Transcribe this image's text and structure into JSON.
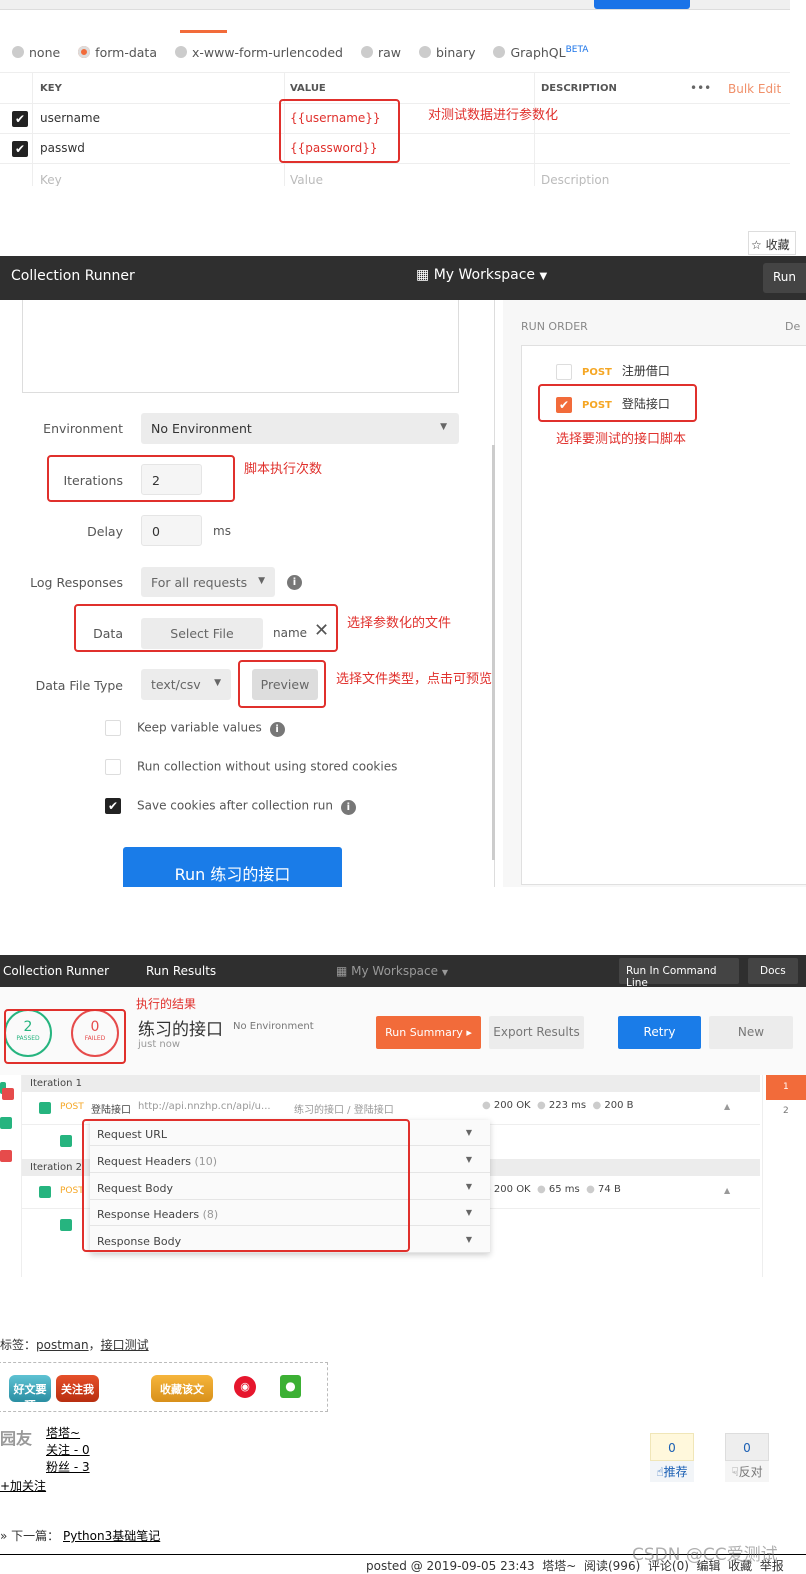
{
  "body_panel": {
    "body_types": [
      {
        "label": "none",
        "selected": false
      },
      {
        "label": "form-data",
        "selected": true
      },
      {
        "label": "x-www-form-urlencoded",
        "selected": false
      },
      {
        "label": "raw",
        "selected": false
      },
      {
        "label": "binary",
        "selected": false
      },
      {
        "label": "GraphQL",
        "selected": false
      }
    ],
    "beta_badge": "BETA",
    "table": {
      "headers": [
        "KEY",
        "VALUE",
        "DESCRIPTION"
      ],
      "more": "•••",
      "bulk_edit": "Bulk Edit",
      "rows": [
        {
          "checked": true,
          "key": "username",
          "value": "{{username}}"
        },
        {
          "checked": true,
          "key": "passwd",
          "value": "{{password}}"
        }
      ],
      "placeholder": {
        "key": "Key",
        "value": "Value",
        "description": "Description"
      }
    },
    "annotation": "对测试数据进行参数化"
  },
  "favorite_button": "☆ 收藏",
  "runner": {
    "title": "Collection Runner",
    "workspace": "My Workspace",
    "run_btn": "Run",
    "fields": {
      "environment_label": "Environment",
      "environment_value": "No Environment",
      "iterations_label": "Iterations",
      "iterations_value": "2",
      "delay_label": "Delay",
      "delay_value": "0",
      "delay_unit": "ms",
      "log_label": "Log Responses",
      "log_value": "For all requests",
      "data_label": "Data",
      "select_file": "Select File",
      "file_name": "name",
      "file_type_label": "Data File Type",
      "file_type_value": "text/csv",
      "preview": "Preview"
    },
    "checkboxes": [
      {
        "label": "Keep variable values",
        "checked": false,
        "info": true
      },
      {
        "label": "Run collection without using stored cookies",
        "checked": false,
        "info": false
      },
      {
        "label": "Save cookies after collection run",
        "checked": true,
        "info": true
      }
    ],
    "run_button": "Run 练习的接口",
    "annotations": {
      "iterations": "脚本执行次数",
      "data": "选择参数化的文件",
      "preview": "选择文件类型，点击可预览",
      "run_order": "选择要测试的接口脚本"
    },
    "run_order": {
      "title": "RUN ORDER",
      "deselect": "De",
      "items": [
        {
          "method": "POST",
          "name": "注册借口",
          "checked": false
        },
        {
          "method": "POST",
          "name": "登陆接口",
          "checked": true
        }
      ]
    }
  },
  "results": {
    "breadcrumbs": [
      "Collection Runner",
      "Run Results"
    ],
    "workspace": "My Workspace",
    "run_cli": "Run In Command Line",
    "docs": "Docs",
    "annotation": "执行的结果",
    "passed": {
      "count": "2",
      "label": "PASSED"
    },
    "failed": {
      "count": "0",
      "label": "FAILED"
    },
    "collection": "练习的接口",
    "environment": "No Environment",
    "time": "just now",
    "buttons": {
      "summary": "Run Summary",
      "export": "Export Results",
      "retry": "Retry",
      "new": "New"
    },
    "iterations": [
      {
        "label": "Iteration 1",
        "method": "POST",
        "name": "登陆接口",
        "url": "http://api.nnzhp.cn/api/u...",
        "path": "练习的接口 / 登陆接口",
        "status": "200 OK",
        "time": "223 ms",
        "size": "200 B"
      },
      {
        "label": "Iteration 2",
        "method": "POST",
        "name": "",
        "url": "",
        "path": "",
        "status": "200 OK",
        "time": "65 ms",
        "size": "74 B"
      }
    ],
    "dropdown": [
      {
        "label": "Request URL",
        "count": ""
      },
      {
        "label": "Request Headers",
        "count": "(10)"
      },
      {
        "label": "Request Body",
        "count": ""
      },
      {
        "label": "Response Headers",
        "count": "(8)"
      },
      {
        "label": "Response Body",
        "count": ""
      }
    ],
    "iteration_nav": [
      "1",
      "2"
    ]
  },
  "blog": {
    "tags_label": "标签：",
    "tags": [
      "postman",
      "接口测试"
    ],
    "share_buttons": [
      "好文要顶",
      "关注我",
      "收藏该文"
    ],
    "author": "塔塔~",
    "following": "关注 - 0",
    "followers": "粉丝 - 3",
    "follow": "+加关注",
    "avatar_text": "园友",
    "recommend": {
      "count": "0",
      "label": "推荐"
    },
    "oppose": {
      "count": "0",
      "label": "反对"
    },
    "next_label": "» 下一篇：",
    "next_title": "Python3基础笔记",
    "footer": "posted @ 2019-09-05 23:43  塔塔~  阅读(996)  评论(0)  编辑  收藏  举报",
    "watermark": "CSDN @CC爱测试"
  }
}
